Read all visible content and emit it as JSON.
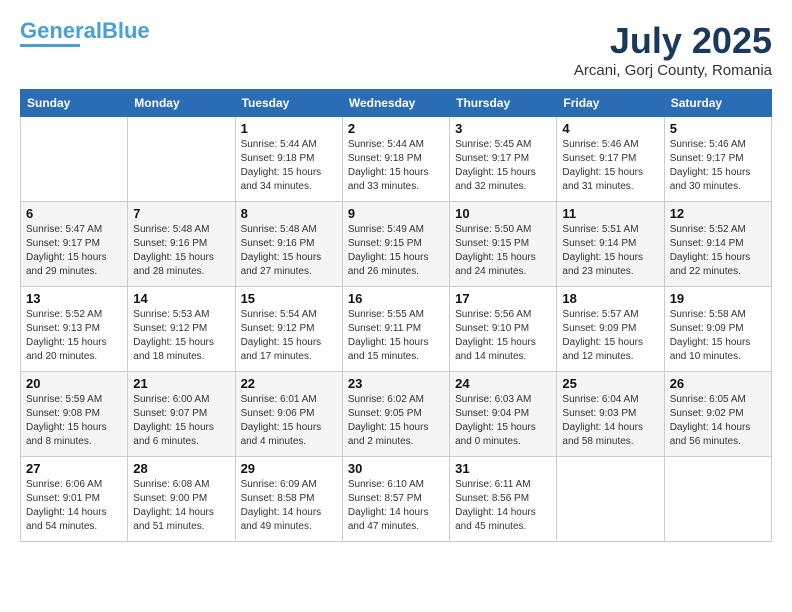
{
  "logo": {
    "part1": "General",
    "part2": "Blue"
  },
  "title": {
    "month_year": "July 2025",
    "location": "Arcani, Gorj County, Romania"
  },
  "days_of_week": [
    "Sunday",
    "Monday",
    "Tuesday",
    "Wednesday",
    "Thursday",
    "Friday",
    "Saturday"
  ],
  "weeks": [
    [
      {
        "day": "",
        "info": ""
      },
      {
        "day": "",
        "info": ""
      },
      {
        "day": "1",
        "info": "Sunrise: 5:44 AM\nSunset: 9:18 PM\nDaylight: 15 hours\nand 34 minutes."
      },
      {
        "day": "2",
        "info": "Sunrise: 5:44 AM\nSunset: 9:18 PM\nDaylight: 15 hours\nand 33 minutes."
      },
      {
        "day": "3",
        "info": "Sunrise: 5:45 AM\nSunset: 9:17 PM\nDaylight: 15 hours\nand 32 minutes."
      },
      {
        "day": "4",
        "info": "Sunrise: 5:46 AM\nSunset: 9:17 PM\nDaylight: 15 hours\nand 31 minutes."
      },
      {
        "day": "5",
        "info": "Sunrise: 5:46 AM\nSunset: 9:17 PM\nDaylight: 15 hours\nand 30 minutes."
      }
    ],
    [
      {
        "day": "6",
        "info": "Sunrise: 5:47 AM\nSunset: 9:17 PM\nDaylight: 15 hours\nand 29 minutes."
      },
      {
        "day": "7",
        "info": "Sunrise: 5:48 AM\nSunset: 9:16 PM\nDaylight: 15 hours\nand 28 minutes."
      },
      {
        "day": "8",
        "info": "Sunrise: 5:48 AM\nSunset: 9:16 PM\nDaylight: 15 hours\nand 27 minutes."
      },
      {
        "day": "9",
        "info": "Sunrise: 5:49 AM\nSunset: 9:15 PM\nDaylight: 15 hours\nand 26 minutes."
      },
      {
        "day": "10",
        "info": "Sunrise: 5:50 AM\nSunset: 9:15 PM\nDaylight: 15 hours\nand 24 minutes."
      },
      {
        "day": "11",
        "info": "Sunrise: 5:51 AM\nSunset: 9:14 PM\nDaylight: 15 hours\nand 23 minutes."
      },
      {
        "day": "12",
        "info": "Sunrise: 5:52 AM\nSunset: 9:14 PM\nDaylight: 15 hours\nand 22 minutes."
      }
    ],
    [
      {
        "day": "13",
        "info": "Sunrise: 5:52 AM\nSunset: 9:13 PM\nDaylight: 15 hours\nand 20 minutes."
      },
      {
        "day": "14",
        "info": "Sunrise: 5:53 AM\nSunset: 9:12 PM\nDaylight: 15 hours\nand 18 minutes."
      },
      {
        "day": "15",
        "info": "Sunrise: 5:54 AM\nSunset: 9:12 PM\nDaylight: 15 hours\nand 17 minutes."
      },
      {
        "day": "16",
        "info": "Sunrise: 5:55 AM\nSunset: 9:11 PM\nDaylight: 15 hours\nand 15 minutes."
      },
      {
        "day": "17",
        "info": "Sunrise: 5:56 AM\nSunset: 9:10 PM\nDaylight: 15 hours\nand 14 minutes."
      },
      {
        "day": "18",
        "info": "Sunrise: 5:57 AM\nSunset: 9:09 PM\nDaylight: 15 hours\nand 12 minutes."
      },
      {
        "day": "19",
        "info": "Sunrise: 5:58 AM\nSunset: 9:09 PM\nDaylight: 15 hours\nand 10 minutes."
      }
    ],
    [
      {
        "day": "20",
        "info": "Sunrise: 5:59 AM\nSunset: 9:08 PM\nDaylight: 15 hours\nand 8 minutes."
      },
      {
        "day": "21",
        "info": "Sunrise: 6:00 AM\nSunset: 9:07 PM\nDaylight: 15 hours\nand 6 minutes."
      },
      {
        "day": "22",
        "info": "Sunrise: 6:01 AM\nSunset: 9:06 PM\nDaylight: 15 hours\nand 4 minutes."
      },
      {
        "day": "23",
        "info": "Sunrise: 6:02 AM\nSunset: 9:05 PM\nDaylight: 15 hours\nand 2 minutes."
      },
      {
        "day": "24",
        "info": "Sunrise: 6:03 AM\nSunset: 9:04 PM\nDaylight: 15 hours\nand 0 minutes."
      },
      {
        "day": "25",
        "info": "Sunrise: 6:04 AM\nSunset: 9:03 PM\nDaylight: 14 hours\nand 58 minutes."
      },
      {
        "day": "26",
        "info": "Sunrise: 6:05 AM\nSunset: 9:02 PM\nDaylight: 14 hours\nand 56 minutes."
      }
    ],
    [
      {
        "day": "27",
        "info": "Sunrise: 6:06 AM\nSunset: 9:01 PM\nDaylight: 14 hours\nand 54 minutes."
      },
      {
        "day": "28",
        "info": "Sunrise: 6:08 AM\nSunset: 9:00 PM\nDaylight: 14 hours\nand 51 minutes."
      },
      {
        "day": "29",
        "info": "Sunrise: 6:09 AM\nSunset: 8:58 PM\nDaylight: 14 hours\nand 49 minutes."
      },
      {
        "day": "30",
        "info": "Sunrise: 6:10 AM\nSunset: 8:57 PM\nDaylight: 14 hours\nand 47 minutes."
      },
      {
        "day": "31",
        "info": "Sunrise: 6:11 AM\nSunset: 8:56 PM\nDaylight: 14 hours\nand 45 minutes."
      },
      {
        "day": "",
        "info": ""
      },
      {
        "day": "",
        "info": ""
      }
    ]
  ]
}
